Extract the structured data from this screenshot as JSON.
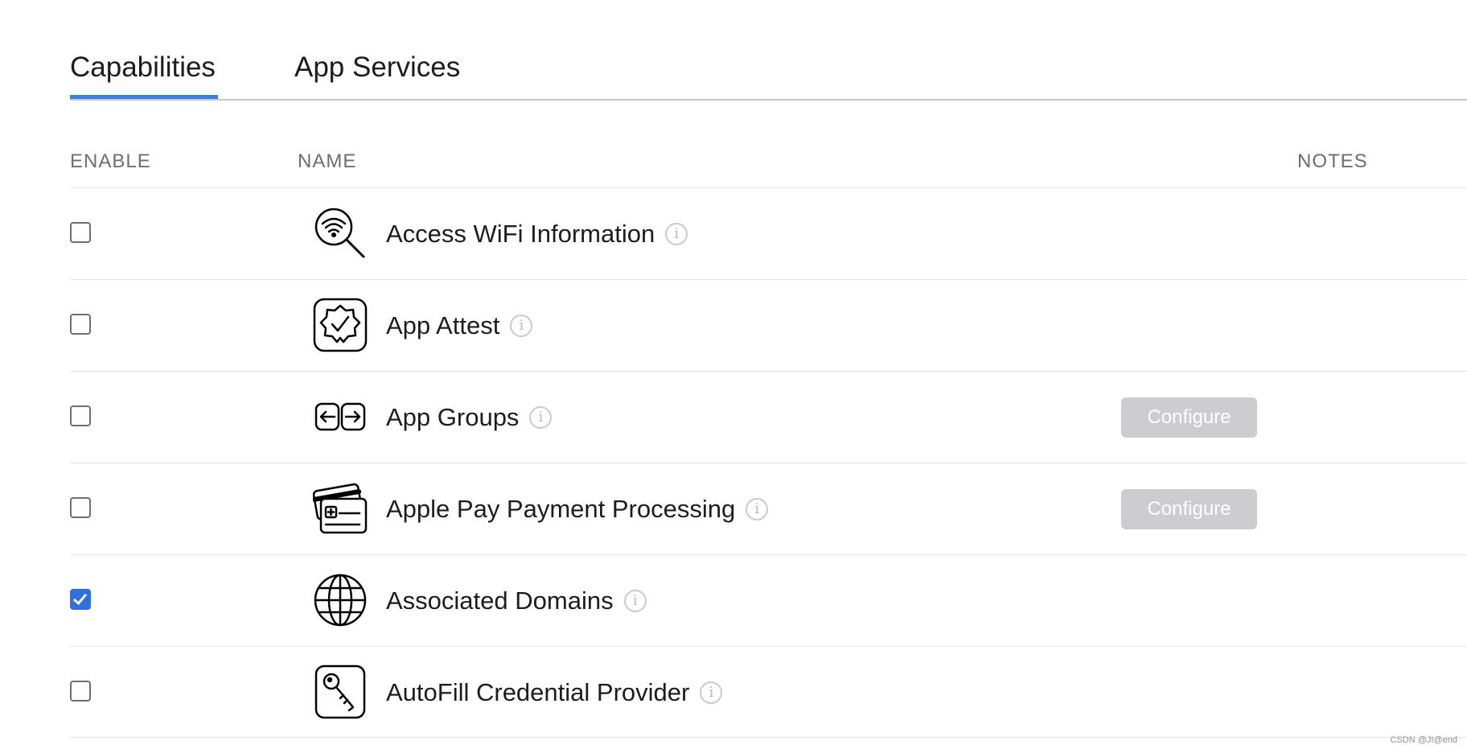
{
  "tabs": [
    {
      "label": "Capabilities",
      "active": true
    },
    {
      "label": "App Services",
      "active": false
    }
  ],
  "columns": {
    "enable": "ENABLE",
    "name": "NAME",
    "notes": "NOTES"
  },
  "rows": [
    {
      "name": "Access WiFi Information",
      "icon": "wifi-search-icon",
      "checked": false,
      "configure": null
    },
    {
      "name": "App Attest",
      "icon": "badge-check-icon",
      "checked": false,
      "configure": null
    },
    {
      "name": "App Groups",
      "icon": "app-groups-icon",
      "checked": false,
      "configure": "Configure"
    },
    {
      "name": "Apple Pay Payment Processing",
      "icon": "payment-cards-icon",
      "checked": false,
      "configure": "Configure"
    },
    {
      "name": "Associated Domains",
      "icon": "globe-icon",
      "checked": true,
      "configure": null
    },
    {
      "name": "AutoFill Credential Provider",
      "icon": "key-icon",
      "checked": false,
      "configure": null
    }
  ],
  "info_glyph": "i",
  "watermark": "CSDN @JI@end",
  "colors": {
    "accent": "#3a7fe4",
    "checkbox_checked": "#2f6fe0",
    "configure_disabled": "#cdcdd1"
  }
}
